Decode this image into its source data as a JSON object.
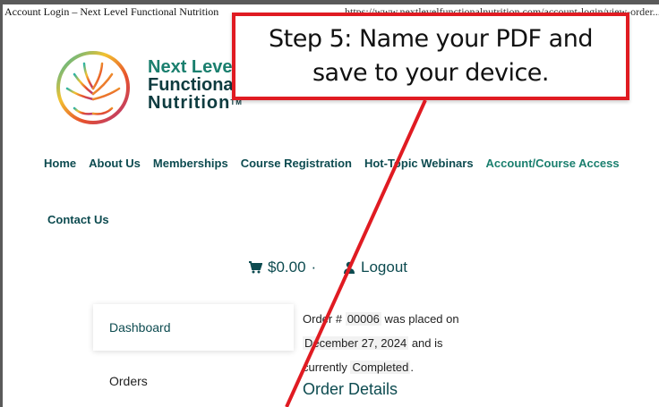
{
  "print_header": {
    "title": "Account Login – Next Level Functional Nutrition",
    "url": "https://www.nextlevelfunctionalnutrition.com/account-login/view-order..."
  },
  "brand": {
    "line1": "Next Level",
    "line2": "Functional",
    "line3": "Nutrition",
    "tm": "TM"
  },
  "nav": {
    "items": [
      "Home",
      "About Us",
      "Memberships",
      "Course Registration",
      "Hot-Topic Webinars",
      "Account/Course Access"
    ],
    "contact": "Contact Us"
  },
  "header_actions": {
    "cart_total": "$0.00",
    "cart_suffix": "·",
    "logout": "Logout"
  },
  "sidebar": {
    "items": [
      "Dashboard",
      "Orders"
    ]
  },
  "order": {
    "prefix": "Order #",
    "number": "00006",
    "placed": "was placed on",
    "date": "December 27, 2024",
    "and_is": "and is",
    "currently": "currently",
    "status": "Completed",
    "period": ".",
    "details_heading": "Order Details"
  },
  "callout": {
    "line1": "Step 5: Name your PDF and",
    "line2": "save to your device."
  },
  "colors": {
    "teal": "#1a7f6e",
    "dark_teal": "#0d4b50",
    "callout_red": "#e01b22"
  }
}
